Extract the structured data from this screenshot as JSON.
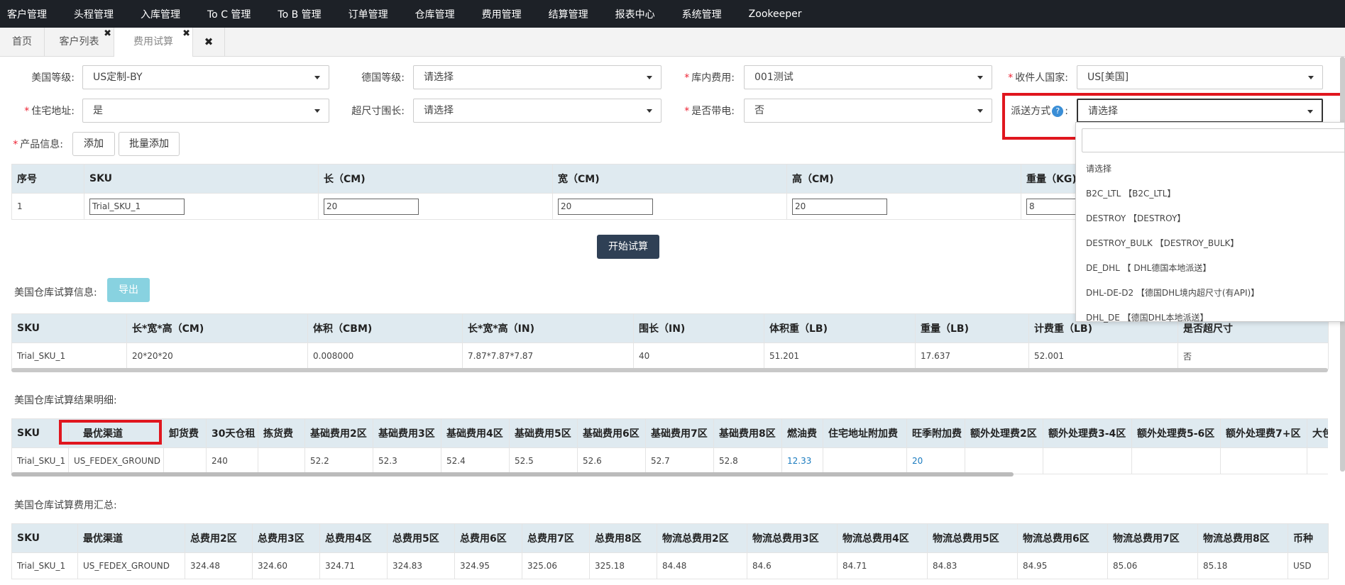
{
  "nav": [
    "客户管理",
    "头程管理",
    "入库管理",
    "To C 管理",
    "To B 管理",
    "订单管理",
    "仓库管理",
    "费用管理",
    "结算管理",
    "报表中心",
    "系统管理",
    "Zookeeper"
  ],
  "tabs": {
    "home": "首页",
    "customer_list": "客户列表",
    "fee_trial": "费用试算",
    "close_glyph": "✖"
  },
  "form": {
    "us_level": {
      "label": "美国等级:",
      "value": "US定制-BY"
    },
    "de_level": {
      "label": "德国等级:",
      "value": "请选择"
    },
    "warehouse_fee": {
      "label": "库内费用:",
      "value": "001测试"
    },
    "country": {
      "label": "收件人国家:",
      "value": "US[美国]"
    },
    "residential": {
      "label": "住宅地址:",
      "value": "是"
    },
    "oversize": {
      "label": "超尺寸围长:",
      "value": "请选择"
    },
    "battery": {
      "label": "是否带电:",
      "value": "否"
    },
    "delivery": {
      "label": "派送方式",
      "colon": ":",
      "help": "?",
      "value": "请选择"
    },
    "product": {
      "label": "产品信息:",
      "add": "添加",
      "batch_add": "批量添加"
    }
  },
  "product_table": {
    "headers": [
      "序号",
      "SKU",
      "长（CM)",
      "宽（CM)",
      "高（CM)",
      "重量（KG)"
    ],
    "row": {
      "index": "1",
      "sku": "Trial_SKU_1",
      "length": "20",
      "width": "20",
      "height": "20",
      "weight": "8"
    }
  },
  "start_button": "开始试算",
  "info_section": {
    "title": "美国仓库试算信息:",
    "export": "导出"
  },
  "info_table": {
    "headers": [
      "SKU",
      "长*宽*高（CM)",
      "体积（CBM)",
      "长*宽*高（IN)",
      "围长（IN)",
      "体积重（LB)",
      "重量（LB)",
      "计费重（LB)",
      "是否超尺寸"
    ],
    "row": [
      "Trial_SKU_1",
      "20*20*20",
      "0.008000",
      "7.87*7.87*7.87",
      "40",
      "51.201",
      "17.637",
      "52.001",
      "否"
    ]
  },
  "detail_section": {
    "title": "美国仓库试算结果明细:"
  },
  "detail_table": {
    "headers": [
      "SKU",
      "最优渠道",
      "卸货费",
      "30天仓租",
      "拣货费",
      "基础费用2区",
      "基础费用3区",
      "基础费用4区",
      "基础费用5区",
      "基础费用6区",
      "基础费用7区",
      "基础费用8区",
      "燃油费",
      "住宅地址附加费",
      "旺季附加费",
      "额外处理费2区",
      "额外处理费3-4区",
      "额外处理费5-6区",
      "额外处理费7+区",
      "大包"
    ],
    "row": [
      "Trial_SKU_1",
      "US_FEDEX_GROUND",
      "",
      "240",
      "",
      "52.2",
      "52.3",
      "52.4",
      "52.5",
      "52.6",
      "52.7",
      "52.8",
      "12.33",
      "",
      "20",
      "",
      "",
      "",
      "",
      ""
    ]
  },
  "summary_section": {
    "title": "美国仓库试算费用汇总:"
  },
  "summary_table": {
    "headers": [
      "SKU",
      "最优渠道",
      "总费用2区",
      "总费用3区",
      "总费用4区",
      "总费用5区",
      "总费用6区",
      "总费用7区",
      "总费用8区",
      "物流总费用2区",
      "物流总费用3区",
      "物流总费用4区",
      "物流总费用5区",
      "物流总费用6区",
      "物流总费用7区",
      "物流总费用8区",
      "币种"
    ],
    "row": [
      "Trial_SKU_1",
      "US_FEDEX_GROUND",
      "324.48",
      "324.60",
      "324.71",
      "324.83",
      "324.95",
      "325.06",
      "325.18",
      "84.48",
      "84.6",
      "84.71",
      "84.83",
      "84.95",
      "85.06",
      "85.18",
      "USD"
    ]
  },
  "dropdown_options": [
    "请选择",
    "B2C_LTL 【B2C_LTL】",
    "DESTROY 【DESTROY】",
    "DESTROY_BULK 【DESTROY_BULK】",
    "DE_DHL 【 DHL德国本地派送】",
    "DHL-DE-D2 【德国DHL境内超尺寸(有API)】",
    "DHL_DE 【德国DHL本地派送】"
  ],
  "colors": {
    "nav_bg": "#1d2127",
    "header_bg": "#dfeaf0",
    "primary_button": "#2f4055",
    "export_button": "#88d2e0",
    "highlight": "#e0161e",
    "link_value": "#1a7bbf"
  }
}
